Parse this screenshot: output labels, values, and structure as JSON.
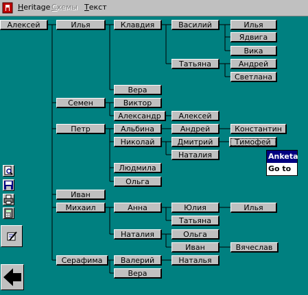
{
  "menubar": {
    "items": [
      {
        "label": "Heritage",
        "accel": "H",
        "rest": "eritage",
        "disabled": false
      },
      {
        "label": "Схемы",
        "accel": "С",
        "rest": "хемы",
        "disabled": true
      },
      {
        "label": "Текст",
        "accel": "Т",
        "rest": "екст",
        "disabled": false
      }
    ]
  },
  "tree": {
    "nodes": {
      "n0": "Алексей",
      "n1": "Илья",
      "n2": "Клавдия",
      "n3": "Василий",
      "n4": "Илья",
      "n5": "Ядвига",
      "n6": "Вика",
      "n7": "Татьяна",
      "n8": "Андрей",
      "n9": "Светлана",
      "n10": "Вера",
      "n11": "Семен",
      "n12": "Виктор",
      "n13": "Александр",
      "n14": "Алексей",
      "n15": "Петр",
      "n16": "Альбина",
      "n17": "Андрей",
      "n18": "Константин",
      "n19": "Николай",
      "n20": "Дмитрий",
      "n21": "Тимофей",
      "n22": "Наталия",
      "n23": "Людмила",
      "n24": "Ольга",
      "n25": "Иван",
      "n26": "Михаил",
      "n27": "Анна",
      "n28": "Юлия",
      "n29": "Илья",
      "n30": "Татьяна",
      "n31": "Наталия",
      "n32": "Ольга",
      "n33": "Иван",
      "n34": "Вячеслав",
      "n35": "Серафима",
      "n36": "Валерий",
      "n37": "Наталья",
      "n38": "Вера"
    }
  },
  "context_menu": {
    "items": [
      {
        "label": "Anketa",
        "selected": true
      },
      {
        "label": "Go to",
        "selected": false
      }
    ]
  },
  "toolbar": {
    "icons": [
      "preview-icon",
      "save-icon",
      "print-icon",
      "calculator-icon",
      "edit-icon",
      "back-arrow-icon"
    ]
  },
  "colors": {
    "background": "#008080",
    "node_face": "#c0c0c0",
    "selection": "#000080"
  }
}
